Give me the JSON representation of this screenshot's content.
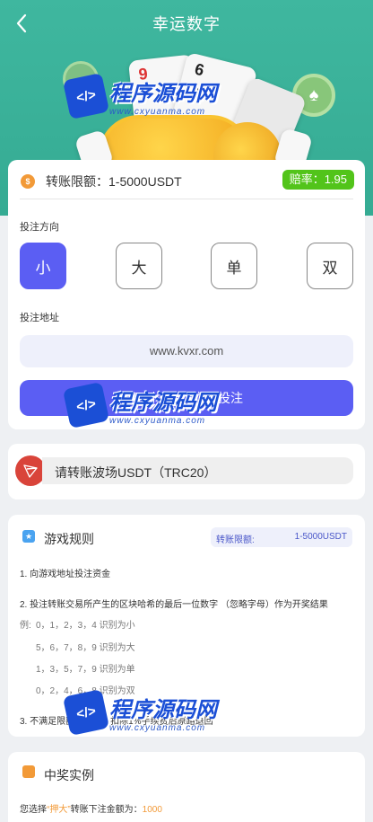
{
  "header": {
    "title": "幸运数字"
  },
  "limit_card": {
    "label": "转账限额：1-5000USDT",
    "odds": "赔率：1.95"
  },
  "bet": {
    "direction_label": "投注方向",
    "options": [
      "小",
      "大",
      "单",
      "双"
    ],
    "address_label": "投注地址",
    "address": "www.kvxr.com",
    "copy_button": "复制地址，立即投注"
  },
  "transfer": {
    "text": "请转账波场USDT（TRC20）"
  },
  "rules": {
    "title": "游戏规则",
    "badge_label": "转账限额:",
    "badge_value": "1-5000USDT",
    "r1": "1. 向游戏地址投注资金",
    "r2": "2. 投注转账交易所产生的区块哈希的最后一位数字 （忽略字母）作为开奖结果",
    "ex_label": "例:",
    "ex1": "0，1，2，3，4 识别为小",
    "ex2": "5，6，7，8，9 识别为大",
    "ex3": "1，3，5，7，9 识别为单",
    "ex4": "0，2，4，6，8 识别为双",
    "r3": "3. 不满足限额的投注，扣除1%手续费后原路退回"
  },
  "example": {
    "title": "中奖实例",
    "line_pre": "您选择",
    "line_choice": "“押大”",
    "line_mid": "转账下注金额为：",
    "line_amount": "1000"
  },
  "watermark": {
    "text": "程序源码网",
    "url": "www.cxyuanma.com"
  },
  "colors": {
    "brand": "#3fb79f",
    "accent": "#5b5ef3",
    "odds_bg": "#52c41a",
    "tron": "#d9443a"
  }
}
